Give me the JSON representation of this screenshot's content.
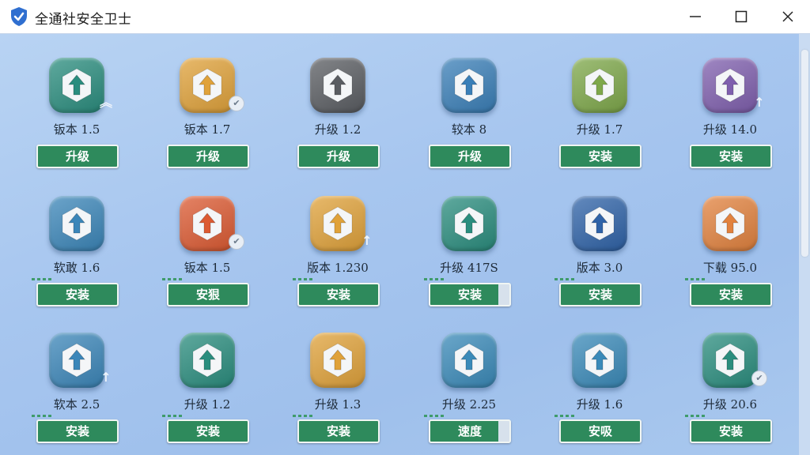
{
  "window": {
    "title": "全通社安全卫士",
    "icon": "shield-check-icon",
    "minimize_icon": "minimize-icon",
    "maximize_icon": "maximize-icon",
    "close_icon": "close-icon"
  },
  "colors": {
    "button": "#2e8a5c",
    "background": "#a7c6ef"
  },
  "grid": [
    [
      {
        "version": "钣本 1.5",
        "button": "升级",
        "icon_color": "#2a8d7e",
        "badge": "up-arrows-icon"
      },
      {
        "version": "钣本 1.7",
        "button": "升级",
        "icon_color": "#e0a23a",
        "badge": "check-icon"
      },
      {
        "version": "升级 1.2",
        "button": "升级",
        "icon_color": "#5a5d62",
        "badge": ""
      },
      {
        "version": "较本 8",
        "button": "升级",
        "icon_color": "#3a7fb8",
        "badge": ""
      },
      {
        "version": "升级 1.7",
        "button": "安装",
        "icon_color": "#7ea84a",
        "badge": ""
      },
      {
        "version": "升级 14.0",
        "button": "安装",
        "icon_color": "#7f5fae",
        "badge": "up-arrow-icon"
      }
    ],
    [
      {
        "version": "软敢 1.6",
        "button": "安装",
        "icon_color": "#3b86b9",
        "badge": ""
      },
      {
        "version": "钣本 1.5",
        "button": "安狠",
        "icon_color": "#dc5a32",
        "badge": "check-icon"
      },
      {
        "version": "版本 1.230",
        "button": "安装",
        "icon_color": "#e0a23a",
        "badge": "up-arrow-icon"
      },
      {
        "version": "升级 417S",
        "button": "安装",
        "icon_color": "#2a8d7e",
        "badge": ""
      },
      {
        "version": "版本 3.0",
        "button": "安装",
        "icon_color": "#2f63a8",
        "badge": ""
      },
      {
        "version": "下载 95.0",
        "button": "安装",
        "icon_color": "#e2823e",
        "badge": ""
      }
    ],
    [
      {
        "version": "软本 2.5",
        "button": "安装",
        "icon_color": "#3b86b9",
        "badge": "up-arrow-icon"
      },
      {
        "version": "升级 1.2",
        "button": "安装",
        "icon_color": "#2a8d7e",
        "badge": ""
      },
      {
        "version": "升级 1.3",
        "button": "安装",
        "icon_color": "#e0a23a",
        "badge": ""
      },
      {
        "version": "升级 2.25",
        "button": "速度",
        "icon_color": "#3a8ab9",
        "badge": ""
      },
      {
        "version": "升级 1.6",
        "button": "安吸",
        "icon_color": "#3a8ab9",
        "badge": ""
      },
      {
        "version": "升级 20.6",
        "button": "安装",
        "icon_color": "#2a8d7e",
        "badge": "check-icon"
      }
    ]
  ]
}
